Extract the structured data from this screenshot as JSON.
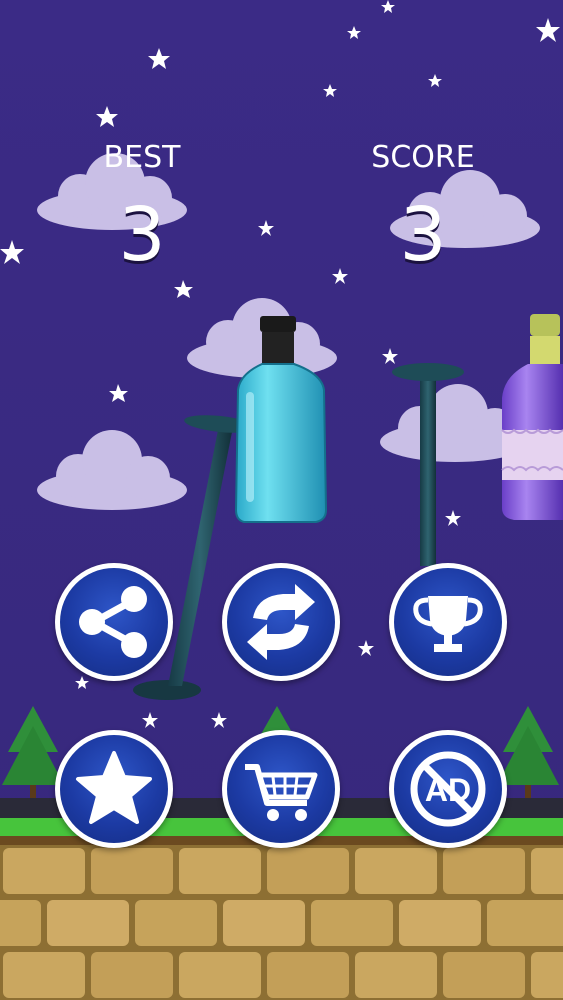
{
  "hud": {
    "best_label": "BEST",
    "best_value": "3",
    "score_label": "SCORE",
    "score_value": "3"
  },
  "menu": {
    "buttons": [
      {
        "name": "share-button",
        "icon": "share-icon"
      },
      {
        "name": "restart-button",
        "icon": "refresh-icon"
      },
      {
        "name": "leaderboard-button",
        "icon": "trophy-icon"
      },
      {
        "name": "rate-button",
        "icon": "star-icon"
      },
      {
        "name": "shop-button",
        "icon": "cart-icon"
      },
      {
        "name": "remove-ads-button",
        "icon": "no-ads-icon",
        "label": "AD"
      }
    ]
  },
  "colors": {
    "sky": "#3a2a82",
    "button_fill": "#1c3aa3",
    "button_ring": "#ffffff",
    "ground_brick": "#c7a45c"
  }
}
